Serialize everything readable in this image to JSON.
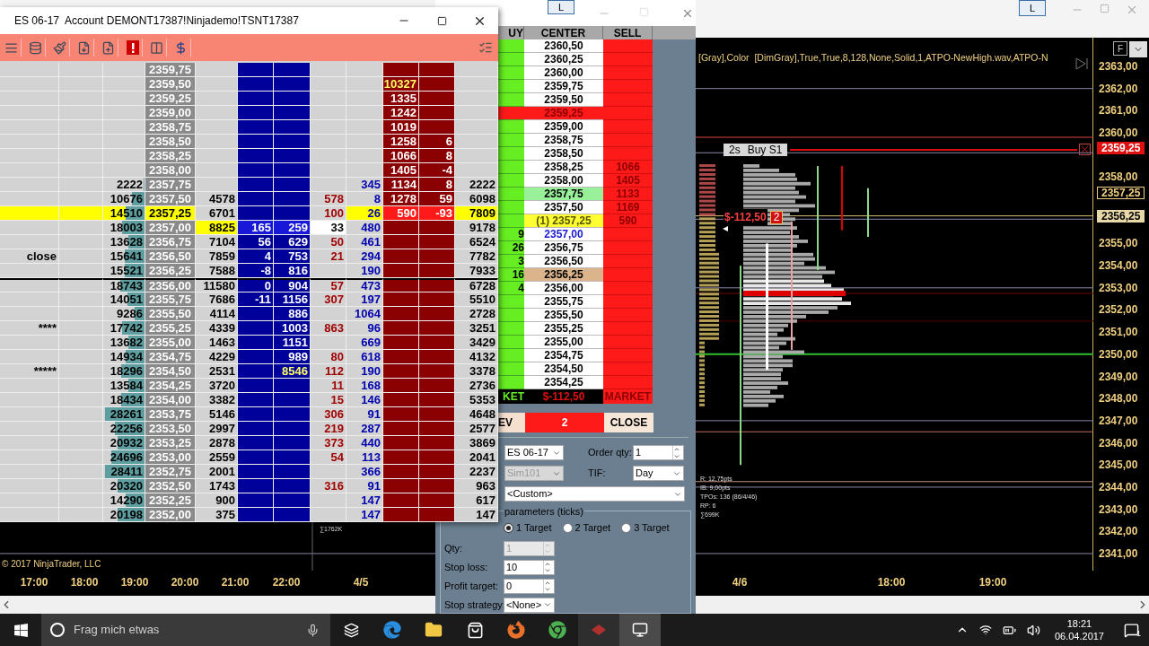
{
  "chart_window": {
    "title_button": "L",
    "header_text": "[Gray],Color  [DimGray],True,True,8,128,None,Solid,1,ATPO-NewHigh.wav,ATPO-N",
    "f_button": "F",
    "price_axis": [
      "2363,00",
      "2362,00",
      "2361,00",
      "2360,00",
      "2358,00",
      "2355,00",
      "2354,00",
      "2353,00",
      "2352,00",
      "2351,00",
      "2350,00",
      "2349,00",
      "2348,00",
      "2347,00",
      "2346,00",
      "2345,00",
      "2344,00",
      "2343,00",
      "2342,00",
      "2341,00"
    ],
    "price_tags": [
      {
        "text": "2359,25",
        "kind": "order"
      },
      {
        "text": "2357,25",
        "kind": "outline"
      },
      {
        "text": "2356,25",
        "kind": "filled"
      }
    ],
    "order_label": {
      "tag": "2s",
      "text": "Buy S1"
    },
    "position_label": {
      "pnl": "$-112,50",
      "qty": "2"
    },
    "stats": [
      "R: 12,75pts",
      "IB: 9,00pts",
      "TPOs: 136 (86/4/46)",
      "RP: 6",
      "∑699K"
    ],
    "volume_note": "∑1762K",
    "copyright": "© 2017 NinjaTrader, LLC",
    "time_axis": [
      "17:00",
      "18:00",
      "19:00",
      "20:00",
      "21:00",
      "22:00",
      "4/5",
      "4/6",
      "18:00",
      "19:00"
    ]
  },
  "ladder_window": {
    "title": "ES 06-17  Account DEMONT17387!Ninjademo!TSNT17387",
    "rows": [
      {
        "cells": [
          null,
          null,
          null,
          "2359,75",
          null,
          null,
          null,
          null,
          null,
          null,
          null,
          null
        ],
        "current": false,
        "separator": false
      },
      {
        "cells": [
          null,
          null,
          null,
          "2359,50",
          null,
          null,
          null,
          null,
          null,
          {
            "text": "10327",
            "kind": "alert"
          },
          null,
          null
        ],
        "current": false,
        "separator": false
      },
      {
        "cells": [
          null,
          null,
          null,
          "2359,25",
          null,
          null,
          null,
          null,
          null,
          "1335",
          null,
          null
        ],
        "current": false,
        "separator": false
      },
      {
        "cells": [
          null,
          null,
          null,
          "2359,00",
          null,
          null,
          null,
          null,
          null,
          "1242",
          null,
          null
        ],
        "current": false,
        "separator": false
      },
      {
        "cells": [
          null,
          null,
          null,
          "2358,75",
          null,
          null,
          null,
          null,
          null,
          "1019",
          null,
          null
        ],
        "current": false,
        "separator": false
      },
      {
        "cells": [
          null,
          null,
          null,
          "2358,50",
          null,
          null,
          null,
          null,
          null,
          "1258",
          "6",
          null
        ],
        "current": false,
        "separator": false
      },
      {
        "cells": [
          null,
          null,
          null,
          "2358,25",
          null,
          null,
          null,
          null,
          null,
          "1066",
          "8",
          null
        ],
        "current": false,
        "separator": false
      },
      {
        "cells": [
          null,
          null,
          null,
          "2358,00",
          null,
          null,
          null,
          null,
          null,
          "1405",
          "-4",
          null
        ],
        "current": false,
        "separator": false
      },
      {
        "cells": [
          null,
          null,
          "2222",
          "2357,75",
          null,
          null,
          null,
          null,
          "345",
          "1134",
          "8",
          "2222"
        ],
        "level": 0.02,
        "current": false,
        "separator": false
      },
      {
        "cells": [
          null,
          null,
          "10676",
          "2357,50",
          "4578",
          null,
          null,
          "578",
          "8",
          "1278",
          "59",
          "6098"
        ],
        "level": 0.3,
        "current": false,
        "separator": false
      },
      {
        "cells": [
          null,
          null,
          "14510",
          "2357,25",
          "6701",
          null,
          null,
          "100",
          "26",
          {
            "text": "590",
            "kind": "hit"
          },
          {
            "text": "-93",
            "kind": "hit"
          },
          "7809"
        ],
        "level": 0.45,
        "current": true,
        "separator": false
      },
      {
        "cells": [
          null,
          null,
          "18003",
          "2357,00",
          {
            "text": "8825",
            "kind": "highlight"
          },
          {
            "text": "165",
            "kind": "bright"
          },
          {
            "text": "259",
            "kind": "bright"
          },
          {
            "text": "33",
            "kind": "marked"
          },
          "480",
          null,
          null,
          "9178"
        ],
        "level": 0.55,
        "current": false,
        "separator": false
      },
      {
        "cells": [
          null,
          null,
          "13628",
          "2356,75",
          "7104",
          "56",
          "629",
          "50",
          "461",
          null,
          null,
          "6524"
        ],
        "level": 0.4,
        "current": false,
        "separator": false
      },
      {
        "cells": [
          "close",
          null,
          "15641",
          "2356,50",
          "7859",
          "4",
          "753",
          "21",
          "294",
          null,
          null,
          "7782"
        ],
        "level": 0.48,
        "current": false,
        "separator": false
      },
      {
        "cells": [
          null,
          null,
          "15521",
          "2356,25",
          "7588",
          "-8",
          "816",
          null,
          "190",
          null,
          null,
          "7933"
        ],
        "level": 0.47,
        "current": false,
        "separator": false
      },
      {
        "cells": [
          null,
          null,
          "18743",
          "2356,00",
          "11580",
          "0",
          "904",
          "57",
          "473",
          null,
          null,
          "6728"
        ],
        "level": 0.58,
        "current": false,
        "separator": true
      },
      {
        "cells": [
          null,
          null,
          "14051",
          "2355,75",
          "7686",
          "-11",
          "1156",
          "307",
          "197",
          null,
          null,
          "5510"
        ],
        "level": 0.42,
        "current": false,
        "separator": false
      },
      {
        "cells": [
          null,
          null,
          "9286",
          "2355,50",
          "4114",
          null,
          "886",
          null,
          "1064",
          null,
          null,
          "2728"
        ],
        "level": 0.25,
        "current": false,
        "separator": false
      },
      {
        "cells": [
          "****",
          null,
          "17742",
          "2355,25",
          "4339",
          null,
          "1003",
          "863",
          "96",
          null,
          null,
          "3251"
        ],
        "level": 0.55,
        "current": false,
        "separator": false
      },
      {
        "cells": [
          null,
          null,
          "13682",
          "2355,00",
          "1463",
          null,
          "1151",
          null,
          "669",
          null,
          null,
          "3429"
        ],
        "level": 0.4,
        "current": false,
        "separator": false
      },
      {
        "cells": [
          null,
          null,
          "14934",
          "2354,75",
          "4229",
          null,
          "989",
          "80",
          "618",
          null,
          null,
          "4132"
        ],
        "level": 0.45,
        "current": false,
        "separator": false
      },
      {
        "cells": [
          "*****",
          null,
          "18296",
          "2354,50",
          "2531",
          null,
          {
            "text": "8546",
            "kind": "alert"
          },
          "112",
          "190",
          null,
          null,
          "3378"
        ],
        "level": 0.57,
        "current": false,
        "separator": false
      },
      {
        "cells": [
          null,
          null,
          "13584",
          "2354,25",
          "3720",
          null,
          null,
          "11",
          "168",
          null,
          null,
          "2736"
        ],
        "level": 0.4,
        "current": false,
        "separator": false
      },
      {
        "cells": [
          null,
          null,
          "18434",
          "2354,00",
          "3382",
          null,
          null,
          "15",
          "146",
          null,
          null,
          "5353"
        ],
        "level": 0.57,
        "current": false,
        "separator": false
      },
      {
        "cells": [
          null,
          null,
          "28261",
          "2353,75",
          "5146",
          null,
          null,
          "306",
          "91",
          null,
          null,
          "4648"
        ],
        "level": 0.95,
        "current": false,
        "separator": false
      },
      {
        "cells": [
          null,
          null,
          "22256",
          "2353,50",
          "2997",
          null,
          null,
          "219",
          "287",
          null,
          null,
          "2577"
        ],
        "level": 0.72,
        "current": false,
        "separator": false
      },
      {
        "cells": [
          null,
          null,
          "20932",
          "2353,25",
          "2878",
          null,
          null,
          "373",
          "440",
          null,
          null,
          "3869"
        ],
        "level": 0.66,
        "current": false,
        "separator": false
      },
      {
        "cells": [
          null,
          null,
          "24696",
          "2353,00",
          "2559",
          null,
          null,
          "54",
          "113",
          null,
          null,
          "2041"
        ],
        "level": 0.8,
        "current": false,
        "separator": false
      },
      {
        "cells": [
          null,
          null,
          "28411",
          "2352,75",
          "2001",
          null,
          null,
          null,
          "366",
          null,
          null,
          "2237"
        ],
        "level": 0.95,
        "current": false,
        "separator": false
      },
      {
        "cells": [
          null,
          null,
          "20320",
          "2352,50",
          "1743",
          null,
          null,
          "316",
          "91",
          null,
          null,
          "963"
        ],
        "level": 0.66,
        "current": false,
        "separator": false
      },
      {
        "cells": [
          null,
          null,
          "14290",
          "2352,25",
          "900",
          null,
          null,
          null,
          "147",
          null,
          null,
          "617"
        ],
        "level": 0.45,
        "current": false,
        "separator": false
      },
      {
        "cells": [
          null,
          null,
          "20198",
          "2352,00",
          "375",
          null,
          null,
          null,
          "147",
          null,
          null,
          "147"
        ],
        "level": 0.65,
        "current": false,
        "separator": false
      }
    ]
  },
  "dom_window": {
    "title_button": "L",
    "columns": [
      "UY",
      "CENTER",
      "SELL"
    ],
    "rows": [
      {
        "buy": null,
        "price": "2360,50",
        "sell": null,
        "kind": "plain"
      },
      {
        "buy": null,
        "price": "2360,25",
        "sell": null,
        "kind": "plain"
      },
      {
        "buy": null,
        "price": "2360,00",
        "sell": null,
        "kind": "plain"
      },
      {
        "buy": null,
        "price": "2359,75",
        "sell": null,
        "kind": "plain"
      },
      {
        "buy": null,
        "price": "2359,50",
        "sell": null,
        "kind": "plain"
      },
      {
        "buy": null,
        "price": "2359,25",
        "sell": null,
        "kind": "order"
      },
      {
        "buy": null,
        "price": "2359,00",
        "sell": null,
        "kind": "plain"
      },
      {
        "buy": null,
        "price": "2358,75",
        "sell": null,
        "kind": "plain"
      },
      {
        "buy": null,
        "price": "2358,50",
        "sell": null,
        "kind": "plain"
      },
      {
        "buy": null,
        "price": "2358,25",
        "sell": "1066",
        "kind": "plain"
      },
      {
        "buy": null,
        "price": "2358,00",
        "sell": "1405",
        "kind": "plain"
      },
      {
        "buy": null,
        "price": "2357,75",
        "sell": "1133",
        "kind": "entry"
      },
      {
        "buy": null,
        "price": "2357,50",
        "sell": "1169",
        "kind": "plain"
      },
      {
        "buy": null,
        "price": "(1) 2357,25",
        "sell": "590",
        "kind": "last"
      },
      {
        "buy": "9",
        "price": "2357,00",
        "sell": null,
        "kind": "bid"
      },
      {
        "buy": "26",
        "price": "2356,75",
        "sell": null,
        "kind": "plain"
      },
      {
        "buy": "3",
        "price": "2356,50",
        "sell": null,
        "kind": "plain"
      },
      {
        "buy": "16",
        "price": "2356,25",
        "sell": null,
        "kind": "open"
      },
      {
        "buy": "4",
        "price": "2356,00",
        "sell": null,
        "kind": "plain"
      },
      {
        "buy": null,
        "price": "2355,75",
        "sell": null,
        "kind": "plain"
      },
      {
        "buy": null,
        "price": "2355,50",
        "sell": null,
        "kind": "plain"
      },
      {
        "buy": null,
        "price": "2355,25",
        "sell": null,
        "kind": "plain"
      },
      {
        "buy": null,
        "price": "2355,00",
        "sell": null,
        "kind": "plain"
      },
      {
        "buy": null,
        "price": "2354,75",
        "sell": null,
        "kind": "plain"
      },
      {
        "buy": null,
        "price": "2354,50",
        "sell": null,
        "kind": "plain"
      },
      {
        "buy": null,
        "price": "2354,25",
        "sell": null,
        "kind": "plain"
      }
    ],
    "market_row": {
      "buy": "KET",
      "center": "$-112,50",
      "sell": "MARKET"
    },
    "actions": [
      {
        "label": "EV",
        "kind": "reverse"
      },
      {
        "label": "2",
        "kind": "position"
      },
      {
        "label": "CLOSE",
        "kind": "close"
      }
    ],
    "form": {
      "instrument": "ES 06-17",
      "order_qty_label": "Order qty:",
      "order_qty": "1",
      "account": "Sim101",
      "tif_label": "TIF:",
      "tif": "Day",
      "strategy": "<Custom>",
      "group_label": "parameters (ticks)",
      "targets": [
        {
          "label": "1 Target",
          "selected": true
        },
        {
          "label": "2 Target",
          "selected": false
        },
        {
          "label": "3 Target",
          "selected": false
        }
      ],
      "fields": [
        {
          "label": "Qty:",
          "value": "1",
          "disabled": true
        },
        {
          "label": "Stop loss:",
          "value": "10",
          "disabled": false
        },
        {
          "label": "Profit target:",
          "value": "0",
          "disabled": false
        }
      ],
      "stop_strategy_label": "Stop strategy:",
      "stop_strategy": "<None>"
    }
  },
  "taskbar": {
    "search_placeholder": "Frag mich etwas",
    "time": "18:21",
    "date": "06.04.2017",
    "notification_count": "1"
  }
}
